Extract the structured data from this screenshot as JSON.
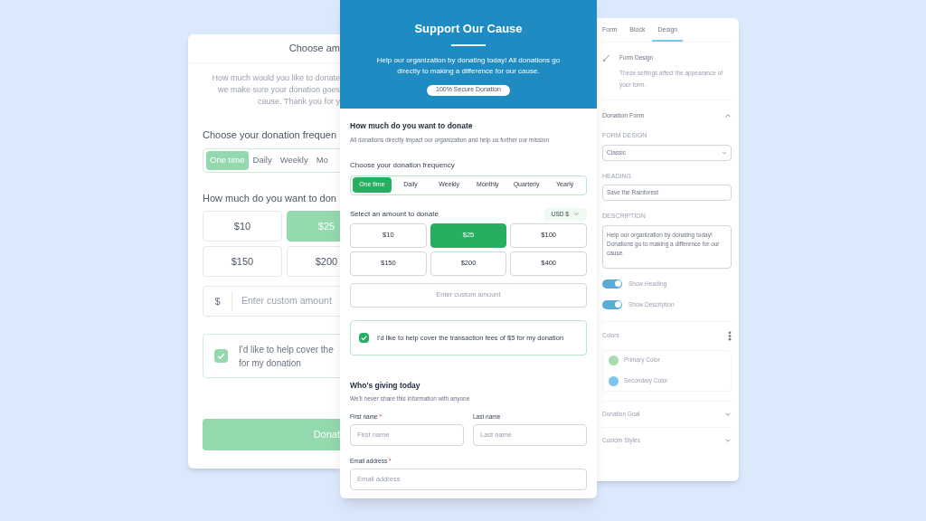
{
  "back_form": {
    "header": "Choose am",
    "intro_lines": [
      "How much would you like to donate",
      "we make sure your donation goes",
      "cause. Thank you for y"
    ],
    "frequency_label": "Choose your donation frequen",
    "frequencies": [
      {
        "label": "One time",
        "selected": true
      },
      {
        "label": "Daily",
        "selected": false
      },
      {
        "label": "Weekly",
        "selected": false
      },
      {
        "label": "Mo",
        "selected": false
      }
    ],
    "amount_label": "How much do you want to don",
    "amounts": [
      {
        "label": "$10",
        "selected": false
      },
      {
        "label": "$25",
        "selected": true
      },
      {
        "label": "$150",
        "selected": false
      },
      {
        "label": "$200",
        "selected": false
      }
    ],
    "currency_symbol": "$",
    "custom_placeholder": "Enter custom amount",
    "cover_fees": {
      "checked": true,
      "lines": [
        "I'd like to help cover the",
        "for my donation"
      ]
    },
    "donate_button": "Donat"
  },
  "main_form": {
    "title": "Support Our Cause",
    "description": "Help our organization by donating today! All donations go directly to making a difference for our cause.",
    "badge": "100% Secure Donation",
    "amount_heading": "How much do you want to donate",
    "amount_subheading": "All donations directly impact our organization and help us further our mission",
    "frequency_label": "Choose your donation frequency",
    "frequencies": [
      {
        "label": "One time",
        "selected": true
      },
      {
        "label": "Daily",
        "selected": false
      },
      {
        "label": "Weekly",
        "selected": false
      },
      {
        "label": "Monthly",
        "selected": false
      },
      {
        "label": "Quarterly",
        "selected": false
      },
      {
        "label": "Yearly",
        "selected": false
      }
    ],
    "amount_label": "Select an amount to donate",
    "currency": "USD $",
    "amounts": [
      {
        "label": "$10",
        "selected": false
      },
      {
        "label": "$25",
        "selected": true
      },
      {
        "label": "$100",
        "selected": false
      },
      {
        "label": "$150",
        "selected": false
      },
      {
        "label": "$200",
        "selected": false
      },
      {
        "label": "$400",
        "selected": false
      }
    ],
    "custom_placeholder": "Enter custom amount",
    "cover_fees": {
      "checked": true,
      "text": "I'd like to help cover the transaction fees of $5 for my donation"
    },
    "donor_heading": "Who's giving today",
    "donor_subheading": "We'll never share this information with anyone",
    "fields": [
      {
        "label": "First name",
        "required_mark": "*",
        "placeholder": "First name"
      },
      {
        "label": "Last name",
        "placeholder": "Last name"
      },
      {
        "label": "Email address",
        "required_mark": "*",
        "placeholder": "Email address"
      }
    ]
  },
  "settings_panel": {
    "tabs": [
      {
        "label": "Form",
        "selected": false
      },
      {
        "label": "Block",
        "selected": false
      },
      {
        "label": "Design",
        "selected": true
      }
    ],
    "info_title": "Form Design",
    "info_description": "These settings affect the appearance of your form.",
    "donation_form": {
      "title": "Donation Form",
      "expanded": true,
      "form_design_label": "FORM DESIGN",
      "form_design_value": "Classic",
      "heading_label": "HEADING",
      "heading_value": "Save the Rainforest",
      "description_label": "DESCRIPTION",
      "description_value": "Help our organization by donating today! Donations go to making a difference for our cause.",
      "toggles": [
        {
          "label": "Show Heading",
          "on": true
        },
        {
          "label": "Show Description",
          "on": true
        }
      ]
    },
    "colors_title": "Colors",
    "colors": [
      {
        "label": "Primary Color",
        "color": "#a8dbae"
      },
      {
        "label": "Secondary Color",
        "color": "#7cc4ef"
      }
    ],
    "collapsed_sections": [
      {
        "title": "Donation Goal",
        "expanded": false
      },
      {
        "title": "Custom Styles",
        "expanded": false
      }
    ]
  }
}
